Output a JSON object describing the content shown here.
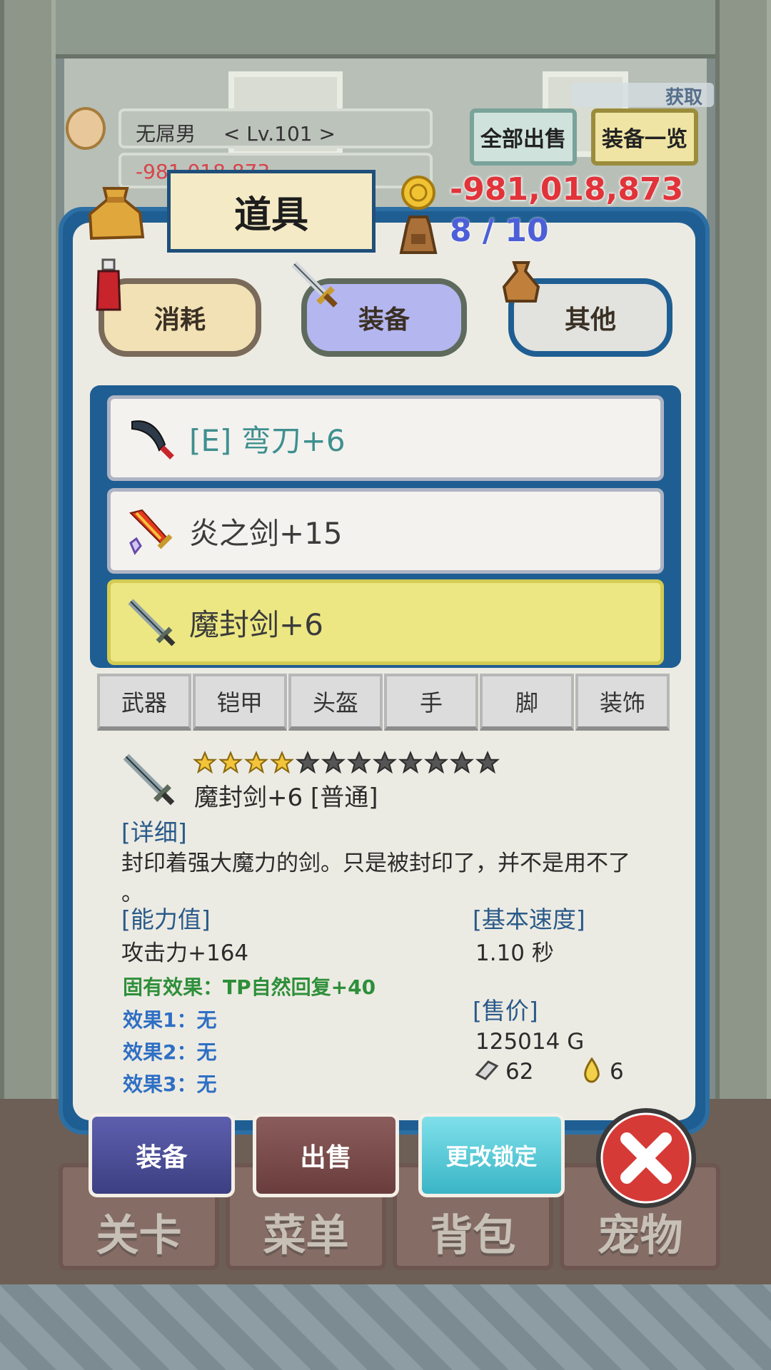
{
  "player": {
    "name": "无屌男",
    "level": "< Lv.101 >",
    "gold_small": "-981,018,873"
  },
  "top_buttons": {
    "sell_all": "全部出售",
    "equip_list": "装备一览",
    "obtain": "获取"
  },
  "panel": {
    "title": "道具",
    "gold": "-981,018,873",
    "bag_count": "8 / 10"
  },
  "tabs": [
    {
      "label": "消耗"
    },
    {
      "label": "装备"
    },
    {
      "label": "其他"
    }
  ],
  "items": [
    {
      "label": "[E] 弯刀+6",
      "icon": "scimitar-icon"
    },
    {
      "label": "炎之剑+15",
      "icon": "flame-sword-icon"
    },
    {
      "label": "魔封剑+6",
      "icon": "sealed-sword-icon"
    }
  ],
  "categories": [
    "武器",
    "铠甲",
    "头盔",
    "手",
    "脚",
    "装饰"
  ],
  "detail": {
    "stars_filled": 4,
    "stars_total": 12,
    "name": "魔封剑+6 [普通]",
    "desc_header": "[详细]",
    "description": "封印着强大魔力的剑。只是被封印了，并不是用不了",
    "description_end": "。",
    "stats_header": "[能力值]",
    "attack": "攻击力+164",
    "inherent": "固有效果：TP自然回复+40",
    "effect1": "效果1：无",
    "effect2": "效果2：无",
    "effect3": "效果3：无",
    "speed_header": "[基本速度]",
    "speed": "1.10 秒",
    "price_header": "[售价]",
    "price": "125014 G",
    "ore": "62",
    "drop": "6"
  },
  "actions": {
    "equip": "装备",
    "sell": "出售",
    "lock": "更改锁定"
  },
  "nav": [
    "关卡",
    "菜单",
    "背包",
    "宠物"
  ],
  "colors": {
    "dialog_border": "#1f5e92",
    "selected_item": "#ece783",
    "gold_text": "#e2333a",
    "bag_text": "#4c5fd8",
    "inherent_effect": "#2e8f3a",
    "effect_blue": "#2f6fc4"
  }
}
